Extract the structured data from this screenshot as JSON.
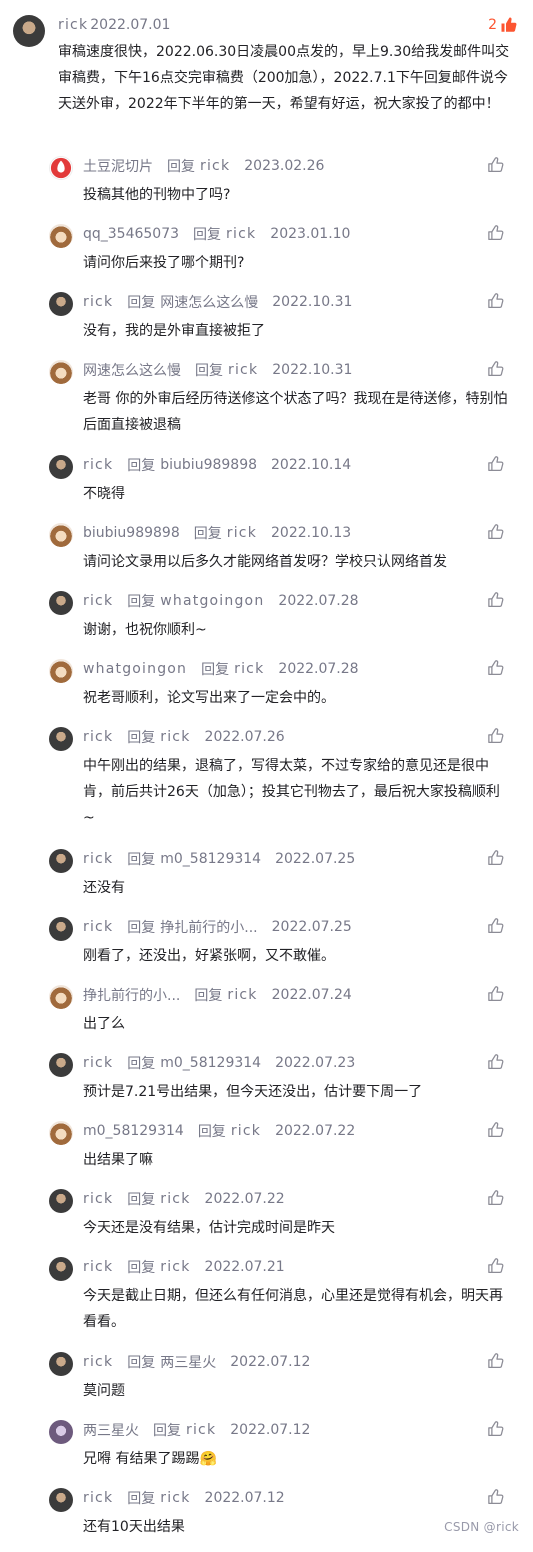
{
  "top_comment": {
    "user": "rick",
    "date": "2022.07.01",
    "likes": "2",
    "content": "审稿速度很快，2022.06.30日凌晨00点发的，早上9.30给我发邮件叫交审稿费，下午16点交完审稿费（200加急），2022.7.1下午回复邮件说今天送外审，2022年下半年的第一天，希望有好运，祝大家投了的都中！"
  },
  "reply_label": "回复",
  "replies": [
    {
      "user": "土豆泥切片",
      "to": "rick",
      "date": "2023.02.26",
      "text": "投稿其他的刊物中了吗?"
    },
    {
      "user": "qq_35465073",
      "to": "rick",
      "date": "2023.01.10",
      "text": "请问你后来投了哪个期刊?"
    },
    {
      "user": "rick",
      "to": "网速怎么这么慢",
      "date": "2022.10.31",
      "text": "没有，我的是外审直接被拒了"
    },
    {
      "user": "网速怎么这么慢",
      "to": "rick",
      "date": "2022.10.31",
      "text": "老哥 你的外审后经历待送修这个状态了吗？我现在是待送修，特别怕后面直接被退稿"
    },
    {
      "user": "rick",
      "to": "biubiu989898",
      "date": "2022.10.14",
      "text": "不晓得"
    },
    {
      "user": "biubiu989898",
      "to": "rick",
      "date": "2022.10.13",
      "text": "请问论文录用以后多久才能网络首发呀？学校只认网络首发"
    },
    {
      "user": "rick",
      "to": "whatgoingon",
      "date": "2022.07.28",
      "text": "谢谢，也祝你顺利~"
    },
    {
      "user": "whatgoingon",
      "to": "rick",
      "date": "2022.07.28",
      "text": "祝老哥顺利，论文写出来了一定会中的。"
    },
    {
      "user": "rick",
      "to": "rick",
      "date": "2022.07.26",
      "text": "中午刚出的结果，退稿了，写得太菜，不过专家给的意见还是很中肯，前后共计26天（加急）；投其它刊物去了，最后祝大家投稿顺利~"
    },
    {
      "user": "rick",
      "to": "m0_58129314",
      "date": "2022.07.25",
      "text": "还没有"
    },
    {
      "user": "rick",
      "to": "挣扎前行的小...",
      "date": "2022.07.25",
      "text": "刚看了，还没出，好紧张啊，又不敢催。"
    },
    {
      "user": "挣扎前行的小...",
      "to": "rick",
      "date": "2022.07.24",
      "text": "出了么"
    },
    {
      "user": "rick",
      "to": "m0_58129314",
      "date": "2022.07.23",
      "text": "预计是7.21号出结果，但今天还没出，估计要下周一了"
    },
    {
      "user": "m0_58129314",
      "to": "rick",
      "date": "2022.07.22",
      "text": "出结果了嘛"
    },
    {
      "user": "rick",
      "to": "rick",
      "date": "2022.07.22",
      "text": "今天还是没有结果，估计完成时间是昨天"
    },
    {
      "user": "rick",
      "to": "rick",
      "date": "2022.07.21",
      "text": "今天是截止日期，但还么有任何消息，心里还是觉得有机会，明天再看看。"
    },
    {
      "user": "rick",
      "to": "两三星火",
      "date": "2022.07.12",
      "text": "莫问题"
    },
    {
      "user": "两三星火",
      "to": "rick",
      "date": "2022.07.12",
      "text": "兄嘚 有结果了踢踢🤗"
    },
    {
      "user": "rick",
      "to": "rick",
      "date": "2022.07.12",
      "text": "还有10天出结果"
    }
  ],
  "watermark": "CSDN @rick",
  "colors": {
    "accent": "#fc5531",
    "meta": "#777888",
    "text": "#222226"
  }
}
